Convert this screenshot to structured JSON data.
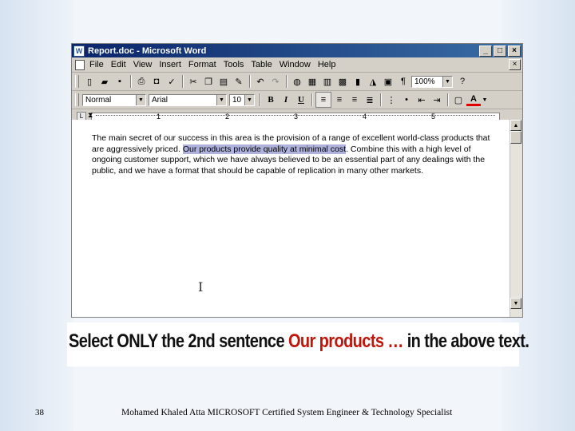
{
  "window": {
    "title": "Report.doc - Microsoft Word",
    "caption_minimize": "_",
    "caption_maximize": "□",
    "caption_close": "×",
    "doc_close": "×"
  },
  "menu": [
    "File",
    "Edit",
    "View",
    "Insert",
    "Format",
    "Tools",
    "Table",
    "Window",
    "Help"
  ],
  "toolbar": {
    "zoom": "100%",
    "style": "Normal",
    "font": "Arial",
    "size": "10",
    "bold": "B",
    "italic": "I",
    "underline": "U",
    "font_color_glyph": "A",
    "pilcrow": "¶"
  },
  "ruler": {
    "numbers": [
      "1",
      "2",
      "3",
      "4",
      "5"
    ]
  },
  "document": {
    "text_before": "The main secret of our success in this area is the provision of a range of excellent world-class products that are aggressively priced. ",
    "text_highlight": "Our products provide quality at minimal cost",
    "text_after": ". Combine this with a high level of ongoing customer support, which we have always believed to be an essential part of any dealings with the public, and we have a format that should be capable of replication in many other markets."
  },
  "instruction": {
    "part1": "Select ONLY the 2nd sentence ",
    "part2": "Our products …",
    "part3": " in the above text."
  },
  "footer": {
    "page_number": "38",
    "text": "Mohamed Khaled Atta MICROSOFT Certified System Engineer & Technology Specialist"
  }
}
